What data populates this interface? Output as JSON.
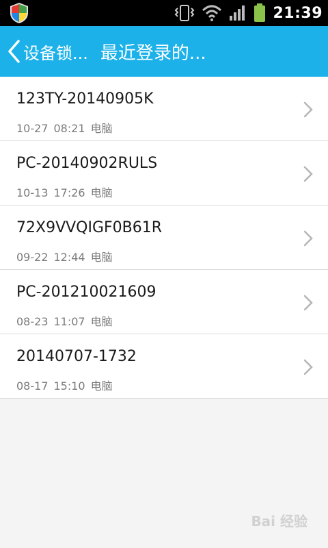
{
  "status_bar": {
    "time": "21:39",
    "icons": [
      "shield-icon",
      "vibrate-icon",
      "wifi-icon",
      "signal-icon",
      "battery-icon"
    ],
    "battery_color": "#8bc34a"
  },
  "header": {
    "back_label": "设备锁...",
    "title": "最近登录的...",
    "background": "#1cb1e9"
  },
  "devices": [
    {
      "name": "123TY-20140905K",
      "date": "10-27",
      "time": "08:21",
      "type": "电脑"
    },
    {
      "name": "PC-20140902RULS",
      "date": "10-13",
      "time": "17:26",
      "type": "电脑"
    },
    {
      "name": "72X9VVQIGF0B61R",
      "date": "09-22",
      "time": "12:44",
      "type": "电脑"
    },
    {
      "name": "PC-201210021609",
      "date": "08-23",
      "time": "11:07",
      "type": "电脑"
    },
    {
      "name": "20140707-1732",
      "date": "08-17",
      "time": "15:10",
      "type": "电脑"
    }
  ],
  "watermark": "Bai 经验"
}
